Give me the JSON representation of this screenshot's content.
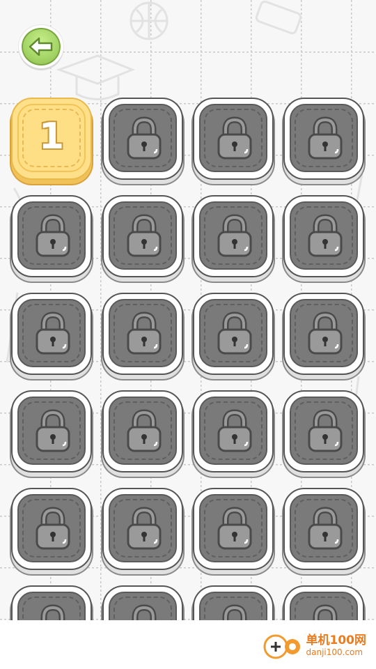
{
  "game": {
    "back_icon": "arrow-left-icon",
    "accent_green": "#a4d466",
    "unlocked_color": "#ffdf85",
    "locked_color": "#7a7a7a",
    "levels": [
      {
        "label": "1",
        "locked": false
      },
      {
        "label": "",
        "locked": true
      },
      {
        "label": "",
        "locked": true
      },
      {
        "label": "",
        "locked": true
      },
      {
        "label": "",
        "locked": true
      },
      {
        "label": "",
        "locked": true
      },
      {
        "label": "",
        "locked": true
      },
      {
        "label": "",
        "locked": true
      },
      {
        "label": "",
        "locked": true
      },
      {
        "label": "",
        "locked": true
      },
      {
        "label": "",
        "locked": true
      },
      {
        "label": "",
        "locked": true
      },
      {
        "label": "",
        "locked": true
      },
      {
        "label": "",
        "locked": true
      },
      {
        "label": "",
        "locked": true
      },
      {
        "label": "",
        "locked": true
      },
      {
        "label": "",
        "locked": true
      },
      {
        "label": "",
        "locked": true
      },
      {
        "label": "",
        "locked": true
      },
      {
        "label": "",
        "locked": true
      },
      {
        "label": "",
        "locked": true
      },
      {
        "label": "",
        "locked": true
      },
      {
        "label": "",
        "locked": true
      },
      {
        "label": "",
        "locked": true
      }
    ]
  },
  "watermark": {
    "title": "单机100网",
    "url": "danji100.com",
    "brand_color": "#ea7b1e"
  }
}
